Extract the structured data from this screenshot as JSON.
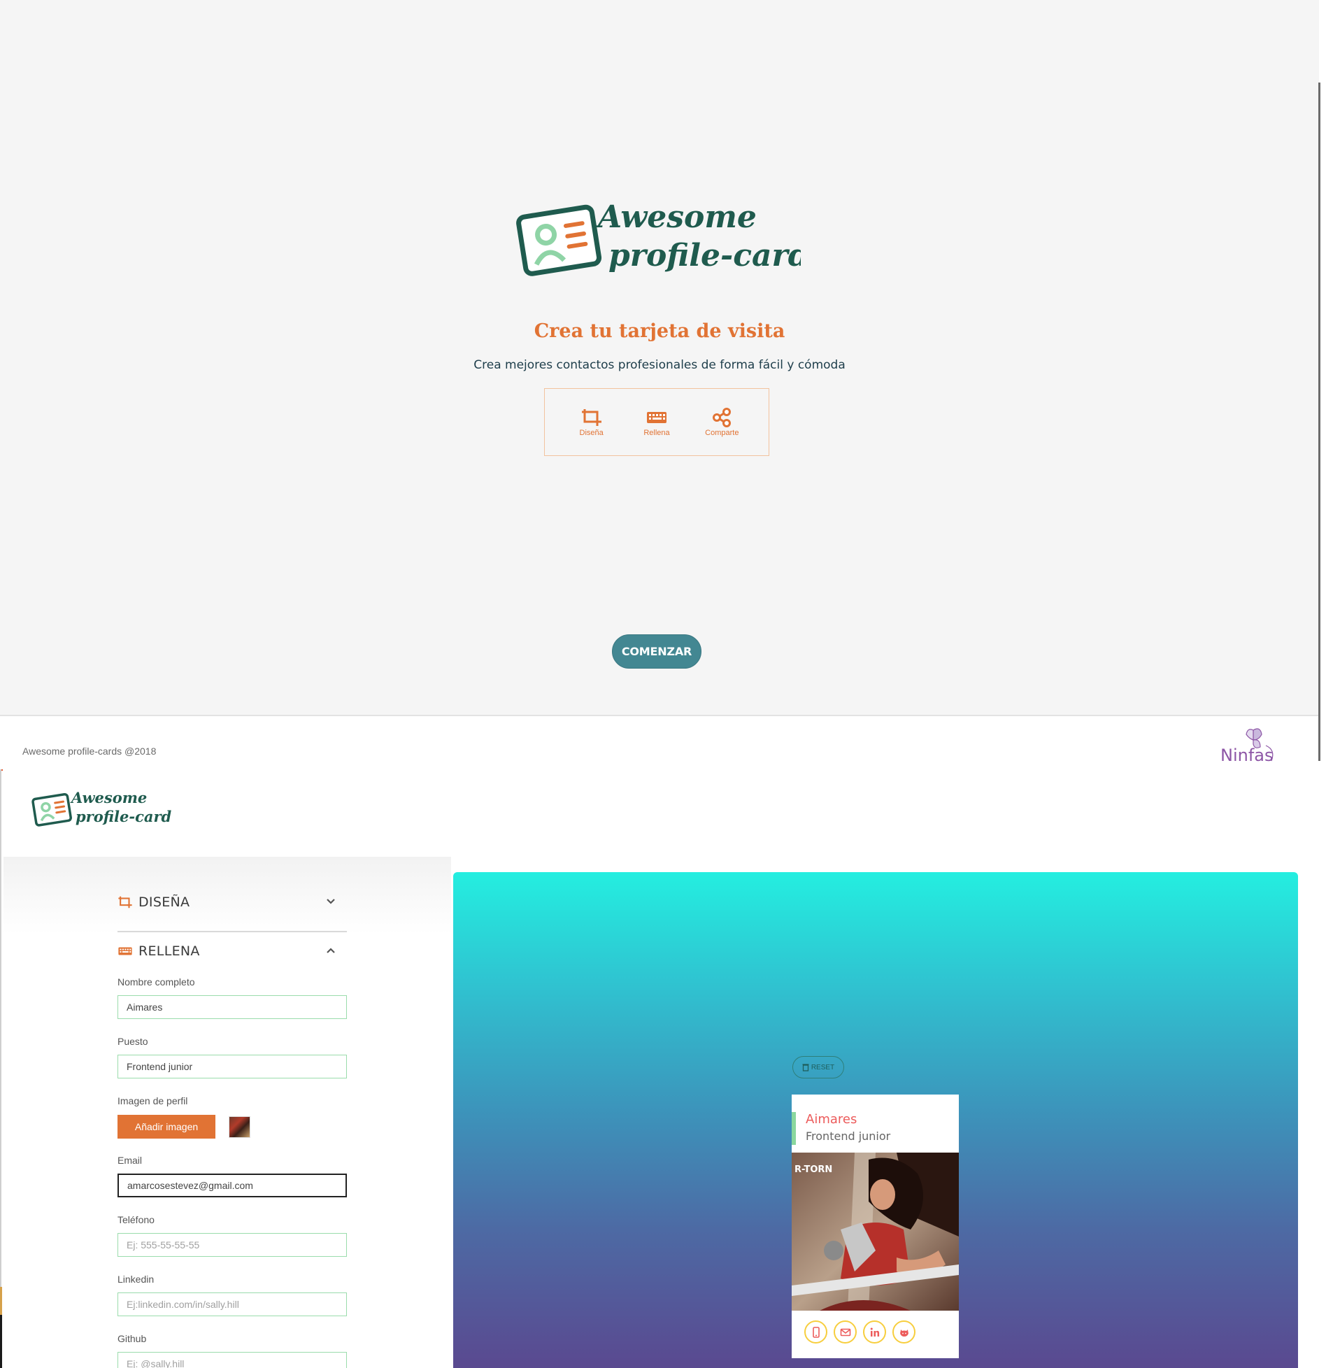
{
  "landing": {
    "logo_line1": "Awesome",
    "logo_line2": "profile-cards",
    "title": "Crea tu tarjeta de visita",
    "subtitle": "Crea mejores contactos profesionales de forma fácil y cómoda",
    "steps": [
      {
        "label": "Diseña",
        "icon": "design-icon"
      },
      {
        "label": "Rellena",
        "icon": "keyboard-icon"
      },
      {
        "label": "Comparte",
        "icon": "share-icon"
      }
    ],
    "start_label": "COMENZAR"
  },
  "footer": {
    "copyright": "Awesome profile-cards @2018",
    "brand": "Ninfas"
  },
  "app": {
    "logo_line1": "Awesome",
    "logo_line2": "profile-cards",
    "sections": {
      "design": {
        "label": "DISEÑA",
        "state": "collapsed"
      },
      "fill": {
        "label": "RELLENA",
        "state": "expanded"
      }
    },
    "form": {
      "name": {
        "label": "Nombre completo",
        "value": "Aimares",
        "placeholder": ""
      },
      "job": {
        "label": "Puesto",
        "value": "Frontend junior",
        "placeholder": ""
      },
      "image": {
        "label": "Imagen de perfil",
        "button": "Añadir imagen"
      },
      "email": {
        "label": "Email",
        "value": "amarcosestevez@gmail.com"
      },
      "phone": {
        "label": "Teléfono",
        "placeholder": "Ej: 555-55-55-55"
      },
      "linkedin": {
        "label": "Linkedin",
        "placeholder": "Ej:linkedin.com/in/sally.hill"
      },
      "github": {
        "label": "Github",
        "placeholder": "Ej: @sally.hill"
      }
    },
    "preview": {
      "reset_label": "RESET",
      "card_name": "Aimares",
      "card_job": "Frontend junior",
      "image_caption": "R-TORN",
      "socials": [
        "phone-icon",
        "mail-icon",
        "linkedin-icon",
        "github-icon"
      ]
    }
  },
  "colors": {
    "orange": "#e17334",
    "teal_dark": "#1f5b4e",
    "button_teal": "#438792",
    "card_name": "#ec5b5b",
    "social_ring": "#f7ce3e",
    "gradient_top": "#24eee0",
    "gradient_bottom": "#5a4990"
  }
}
